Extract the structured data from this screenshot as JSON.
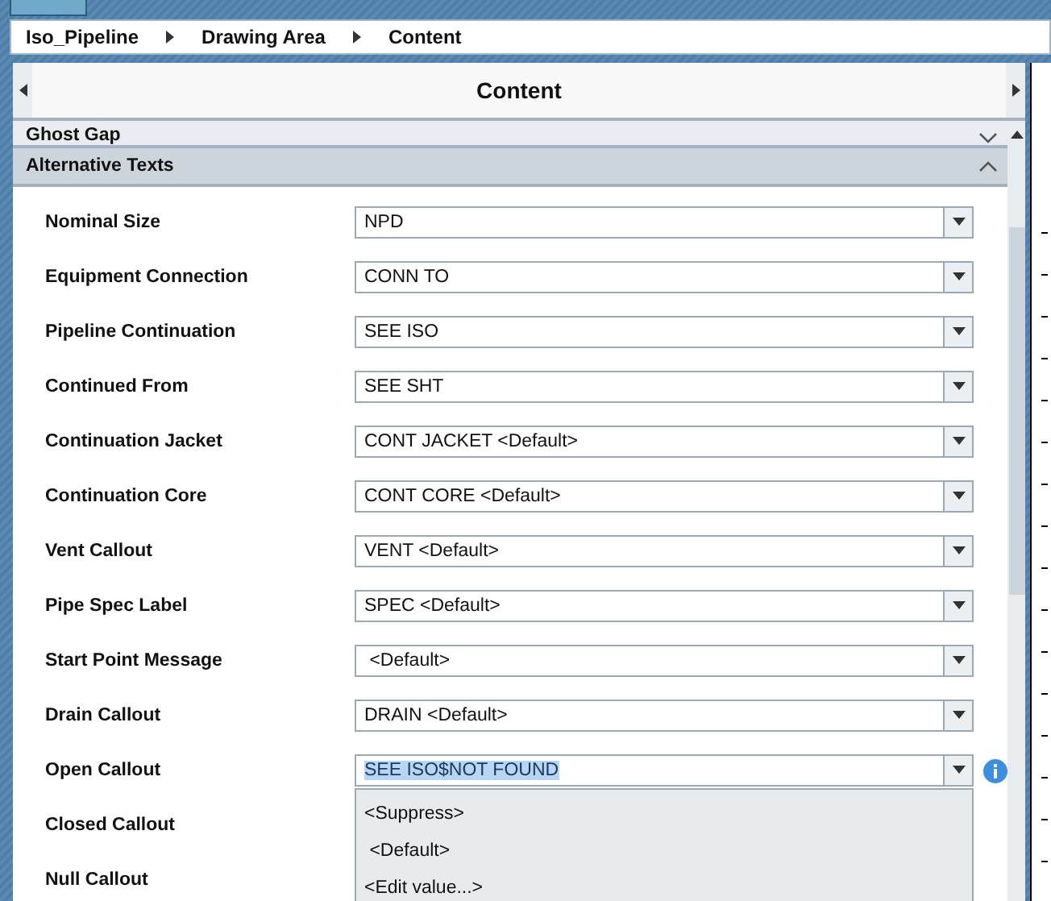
{
  "breadcrumb": [
    "Iso_Pipeline",
    "Drawing Area",
    "Content"
  ],
  "panel": {
    "title": "Content"
  },
  "sections": [
    {
      "title": "Ghost Gap",
      "expanded": false
    },
    {
      "title": "Alternative Texts",
      "expanded": true
    }
  ],
  "rows": [
    {
      "label": "Nominal Size",
      "value": "NPD",
      "open": false
    },
    {
      "label": "Equipment Connection",
      "value": "CONN TO",
      "open": false
    },
    {
      "label": "Pipeline Continuation",
      "value": "SEE ISO",
      "open": false
    },
    {
      "label": "Continued From",
      "value": "SEE SHT",
      "open": false
    },
    {
      "label": "Continuation Jacket",
      "value": "CONT JACKET <Default>",
      "open": false
    },
    {
      "label": "Continuation Core",
      "value": "CONT CORE <Default>",
      "open": false
    },
    {
      "label": "Vent Callout",
      "value": "VENT <Default>",
      "open": false
    },
    {
      "label": "Pipe Spec Label",
      "value": "SPEC <Default>",
      "open": false
    },
    {
      "label": "Start Point Message",
      "value": " <Default>",
      "open": false
    },
    {
      "label": "Drain Callout",
      "value": "DRAIN <Default>",
      "open": false
    },
    {
      "label": "Open Callout",
      "value": "SEE ISO$NOT FOUND",
      "open": true,
      "options": [
        "<Suppress>",
        " <Default>",
        "<Edit value...>"
      ]
    },
    {
      "label": "Closed Callout"
    },
    {
      "label": "Null Callout"
    }
  ]
}
